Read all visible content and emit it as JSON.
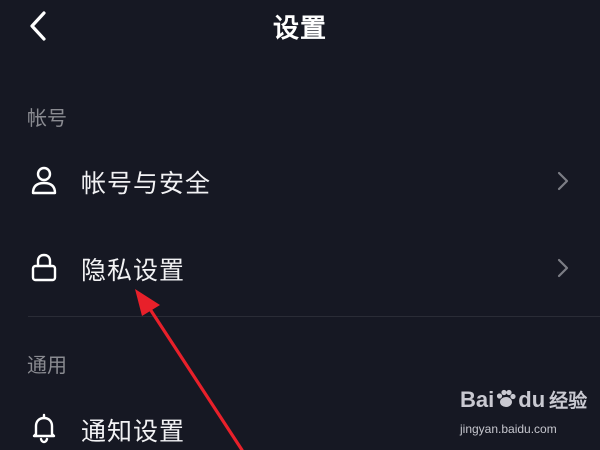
{
  "header": {
    "title": "设置",
    "back_icon": "chevron-left-icon"
  },
  "sections": [
    {
      "label": "帐号",
      "items": [
        {
          "label": "帐号与安全",
          "icon": "user-icon"
        },
        {
          "label": "隐私设置",
          "icon": "lock-icon"
        }
      ]
    },
    {
      "label": "通用",
      "items": [
        {
          "label": "通知设置",
          "icon": "bell-icon"
        }
      ]
    }
  ],
  "watermark": {
    "brand_a": "Bai",
    "brand_b": "du",
    "brand_c": "经验",
    "sub": "jingyan.baidu.com"
  },
  "colors": {
    "background": "#161823",
    "annotation": "#e8202a",
    "muted_text": "#8a8b91"
  }
}
